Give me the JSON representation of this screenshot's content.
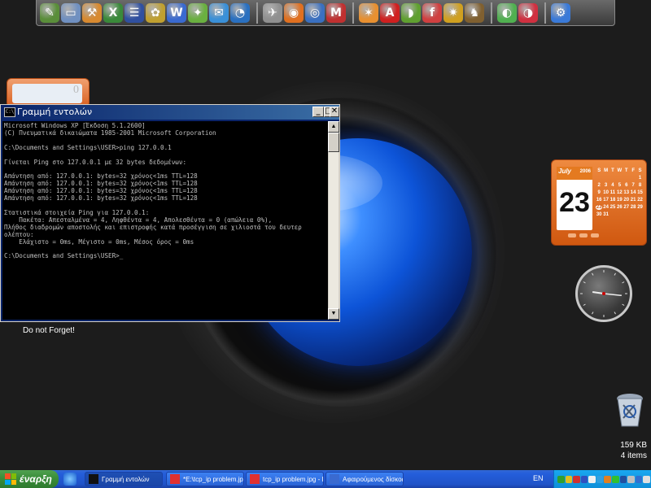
{
  "cmd": {
    "title": "Γραμμή εντολών",
    "lines": [
      "Microsoft Windows XP [Έκδοση 5.1.2600]",
      "(C) Πνευματικά δικαιώματα 1985-2001 Microsoft Corporation",
      "",
      "C:\\Documents and Settings\\USER>ping 127.0.0.1",
      "",
      "Γίνεται Ping στο 127.0.0.1 με 32 bytes δεδομένων:",
      "",
      "Απάντηση από: 127.0.0.1: bytes=32 χρόνος<1ms TTL=128",
      "Απάντηση από: 127.0.0.1: bytes=32 χρόνος<1ms TTL=128",
      "Απάντηση από: 127.0.0.1: bytes=32 χρόνος<1ms TTL=128",
      "Απάντηση από: 127.0.0.1: bytes=32 χρόνος<1ms TTL=128",
      "",
      "Στατιστικά στοιχεία Ping για 127.0.0.1:",
      "    Πακέτα: Απεσταλμένα = 4, Ληφθέντα = 4, Απολεσθέντα = 0 (απώλεια 0%),",
      "Πλήθος διαδρομών αποστολής και επιστροφής κατά προσέγγιση σε χιλιοστά του δευτερ",
      "ολέπτου:",
      "    Ελάχιστο = 0ms, Μέγιστο = 0ms, Μέσος όρος = 0ms",
      "",
      "C:\\Documents and Settings\\USER>_"
    ]
  },
  "note": {
    "label": "Do not Forget!",
    "value": "0"
  },
  "calendar": {
    "month": "July",
    "year": "2006",
    "day": "23",
    "header": [
      "S",
      "M",
      "T",
      "W",
      "T",
      "F",
      "S"
    ],
    "cells": [
      "",
      "",
      "",
      "",
      "",
      "",
      "1",
      "2",
      "3",
      "4",
      "5",
      "6",
      "7",
      "8",
      "9",
      "10",
      "11",
      "12",
      "13",
      "14",
      "15",
      "16",
      "17",
      "18",
      "19",
      "20",
      "21",
      "22",
      "23",
      "24",
      "25",
      "26",
      "27",
      "28",
      "29",
      "30",
      "31"
    ],
    "today": "23"
  },
  "clock": {
    "hour": 9,
    "minute": 16
  },
  "recycle_bin": {
    "size": "159 KB",
    "items": "4 items"
  },
  "taskbar": {
    "start_label": "έναρξη",
    "tasks": [
      {
        "label": "Γραμμή εντολών",
        "active": true
      },
      {
        "label": "*E:\\tcp_ip problem.jp...",
        "active": false
      },
      {
        "label": "tcp_ip problem.jpg - I...",
        "active": false
      },
      {
        "label": "Αφαιρούμενος δίσκος...",
        "active": false
      }
    ],
    "language": "EN"
  },
  "colors": {
    "taskbar_blue": "#245edb",
    "start_green": "#3c8f3c",
    "tray_blue": "#0f8fd8",
    "titlebar_blue": "#0a246a"
  },
  "topbar_icons": [
    "brush-icon",
    "monitor-icon",
    "tools-icon",
    "excel-icon",
    "list-icon",
    "paint-icon",
    "word-icon",
    "network-icon",
    "mail-icon",
    "globe-icon",
    "fax-icon",
    "firefox-icon",
    "thunderbird-icon",
    "maxthon-icon",
    "butterfly-icon",
    "acrobat-icon",
    "winamp-icon",
    "flash-icon",
    "puzzle-icon",
    "chess-icon",
    "green-circle-icon",
    "red-circle-icon",
    "wrench-icon"
  ]
}
